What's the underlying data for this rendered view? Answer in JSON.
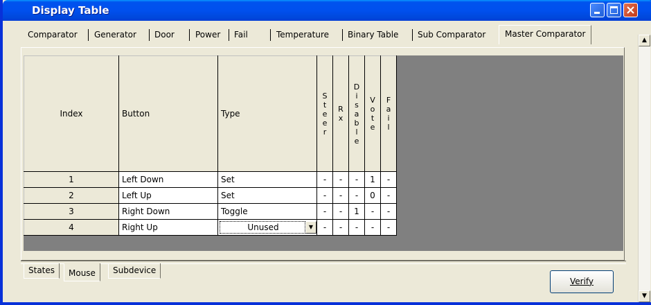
{
  "window": {
    "title": "Display Table"
  },
  "tabs_top": [
    "Comparator",
    "Generator",
    "Door",
    "Power",
    "Fail",
    "Temperature",
    "Binary Table",
    "Sub Comparator",
    "Master Comparator"
  ],
  "tabs_top_active": "Master Comparator",
  "grid": {
    "headers": {
      "index": "Index",
      "button": "Button",
      "type": "Type",
      "steer": [
        "S",
        "t",
        "e",
        "e",
        "r"
      ],
      "rx": [
        "R",
        "x"
      ],
      "disable": [
        "D",
        "i",
        "s",
        "a",
        "b",
        "l",
        "e"
      ],
      "vote": [
        "V",
        "o",
        "t",
        "e"
      ],
      "fail": [
        "F",
        "a",
        "i",
        "l"
      ]
    },
    "rows": [
      {
        "index": "1",
        "button": "Left Down",
        "type": "Set",
        "steer": "-",
        "rx": "-",
        "disable": "-",
        "vote": "1",
        "fail": "-"
      },
      {
        "index": "2",
        "button": "Left Up",
        "type": "Set",
        "steer": "-",
        "rx": "-",
        "disable": "-",
        "vote": "0",
        "fail": "-"
      },
      {
        "index": "3",
        "button": "Right Down",
        "type": "Toggle",
        "steer": "-",
        "rx": "-",
        "disable": "1",
        "vote": "-",
        "fail": "-"
      },
      {
        "index": "4",
        "button": "Right Up",
        "type": "Unused",
        "steer": "-",
        "rx": "-",
        "disable": "-",
        "vote": "-",
        "fail": "-"
      }
    ]
  },
  "tabs_bottom": [
    "States",
    "Mouse",
    "Subdevice"
  ],
  "tabs_bottom_active": "Mouse",
  "verify_label": "Verify"
}
